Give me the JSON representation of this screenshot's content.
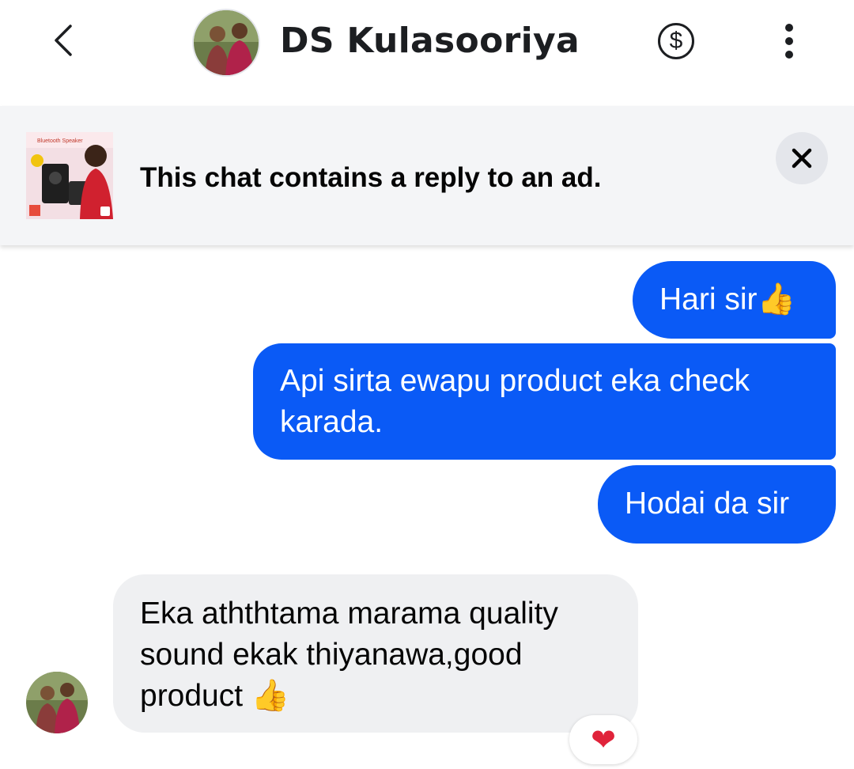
{
  "header": {
    "contact_name": "DS Kulasooriya",
    "back_icon": "chevron-left-icon",
    "money_icon": "dollar-circle-icon",
    "more_icon": "vertical-ellipsis-icon",
    "money_symbol": "$"
  },
  "ad_banner": {
    "notice_text": "This chat contains a reply to an ad.",
    "thumbnail_caption": "Bluetooth Speaker",
    "close_symbol": "✕"
  },
  "messages": [
    {
      "direction": "outgoing",
      "text": "Hari sir",
      "emoji": "👍"
    },
    {
      "direction": "outgoing",
      "text_line1": "Api sirta ewapu product eka check",
      "text_line2": "karada."
    },
    {
      "direction": "outgoing",
      "text": "Hodai da sir"
    },
    {
      "direction": "incoming",
      "text_line1": "Eka aththtama marama quality",
      "text_line2": "sound ekak thiyanawa,good",
      "text_line3": "product ",
      "emoji": "👍",
      "reaction": "❤"
    }
  ],
  "colors": {
    "outgoing_bubble": "#0a5af6",
    "incoming_bubble": "#eff0f2",
    "banner_bg": "#f4f5f7",
    "reaction_heart": "#e0233a"
  }
}
